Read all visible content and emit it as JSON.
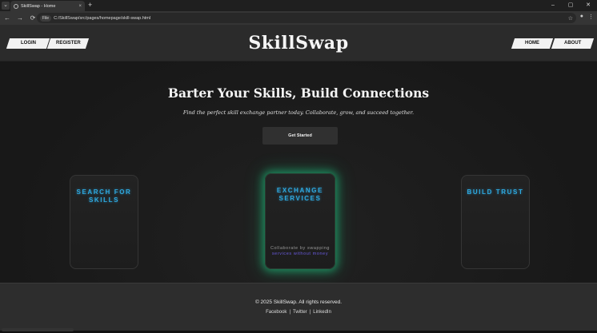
{
  "browser": {
    "tab_title": "SkillSwap - Home",
    "tab_close": "×",
    "new_tab": "+",
    "chip": "File",
    "url": "C:/SkillSwap/src/pages/homepage/skill-swap.html",
    "win_min": "–",
    "win_max": "▢",
    "win_close": "✕",
    "back": "←",
    "forward": "→",
    "reload": "⟳",
    "star": "☆",
    "profile": "●",
    "menu": "⋮"
  },
  "header": {
    "login": "LOGIN",
    "register": "REGISTER",
    "logo": "SkillSwap",
    "home": "HOME",
    "about": "ABOUT"
  },
  "hero": {
    "title": "Barter Your Skills, Build Connections",
    "subtitle": "Find the perfect skill exchange partner today. Collaborate, grow, and succeed together.",
    "cta": "Get Started"
  },
  "cards": [
    {
      "title_line1": "SEARCH FOR",
      "title_line2": "SKILLS"
    },
    {
      "title_line1": "EXCHANGE",
      "title_line2": "SERVICES",
      "desc_line1": "Collaborate by swapping",
      "desc_line2": "services without money"
    },
    {
      "title_line1": "BUILD TRUST",
      "title_line2": ""
    }
  ],
  "footer": {
    "copyright": "© 2025 SkillSwap. All rights reserved.",
    "links": [
      "Facebook",
      "Twitter",
      "LinkedIn"
    ],
    "separator": "|"
  },
  "colors": {
    "accent": "#2ea9e0",
    "glow": "#1ec882",
    "desc_accent": "#6a5be0"
  }
}
